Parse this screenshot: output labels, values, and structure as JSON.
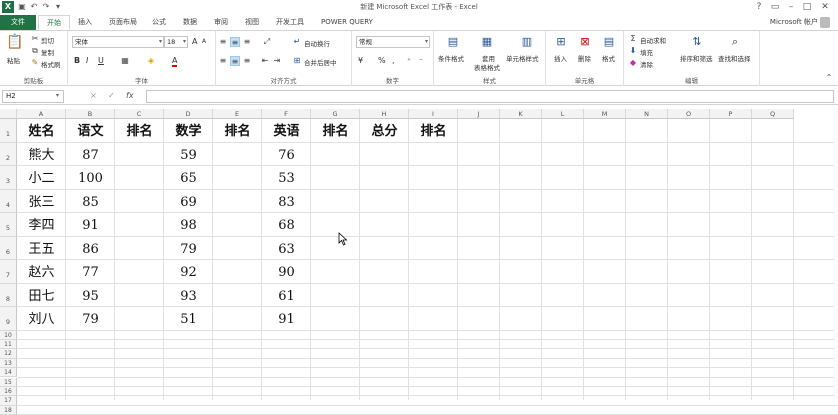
{
  "title": "新建 Microsoft Excel 工作表 - Excel",
  "account": "Microsoft 帐户",
  "tabs": [
    "文件",
    "开始",
    "插入",
    "页面布局",
    "公式",
    "数据",
    "审阅",
    "视图",
    "开发工具",
    "POWER QUERY"
  ],
  "ribbon": {
    "clipboard": {
      "label": "剪贴板",
      "paste": "粘贴",
      "cut": "剪切",
      "copy": "复制",
      "format_painter": "格式刷"
    },
    "font": {
      "label": "字体",
      "name": "宋体",
      "size": "18",
      "bold": "B",
      "italic": "I",
      "underline": "U",
      "font_color_glyph": "A",
      "grow": "A",
      "shrink": "A"
    },
    "alignment": {
      "label": "对齐方式",
      "wrap": "自动换行",
      "merge": "合并后居中"
    },
    "number": {
      "label": "数字",
      "format": "常规",
      "percent": "%",
      "comma": ",",
      "currency": "¥"
    },
    "styles": {
      "label": "样式",
      "conditional": "条件格式",
      "table_line1": "套用",
      "table_line2": "表格格式",
      "cell_styles": "单元格样式"
    },
    "cells": {
      "label": "单元格",
      "insert": "插入",
      "delete": "删除",
      "format": "格式"
    },
    "editing": {
      "label": "编辑",
      "autosum": "自动求和",
      "fill": "填充",
      "clear": "清除",
      "sort_filter": "排序和筛选",
      "find_select": "查找和选择"
    }
  },
  "formula_bar": {
    "name_box": "H2",
    "fx": "fx",
    "cancel": "×",
    "enter": "✓"
  },
  "columns": [
    "A",
    "B",
    "C",
    "D",
    "E",
    "F",
    "G",
    "H",
    "I",
    "J",
    "K",
    "L",
    "M",
    "N",
    "O",
    "P",
    "Q"
  ],
  "rows": [
    "1",
    "2",
    "3",
    "4",
    "5",
    "6",
    "7",
    "8",
    "9",
    "10",
    "11",
    "12",
    "13",
    "14",
    "15",
    "16",
    "17",
    "18"
  ],
  "header_row": [
    "姓名",
    "语文",
    "排名",
    "数学",
    "排名",
    "英语",
    "排名",
    "总分",
    "排名"
  ],
  "data_rows": [
    [
      "熊大",
      "87",
      "",
      "59",
      "",
      "76"
    ],
    [
      "小二",
      "100",
      "",
      "65",
      "",
      "53"
    ],
    [
      "张三",
      "85",
      "",
      "69",
      "",
      "83"
    ],
    [
      "李四",
      "91",
      "",
      "98",
      "",
      "68"
    ],
    [
      "王五",
      "86",
      "",
      "79",
      "",
      "63"
    ],
    [
      "赵六",
      "77",
      "",
      "92",
      "",
      "90"
    ],
    [
      "田七",
      "95",
      "",
      "93",
      "",
      "61"
    ],
    [
      "刘八",
      "79",
      "",
      "51",
      "",
      "91"
    ]
  ]
}
